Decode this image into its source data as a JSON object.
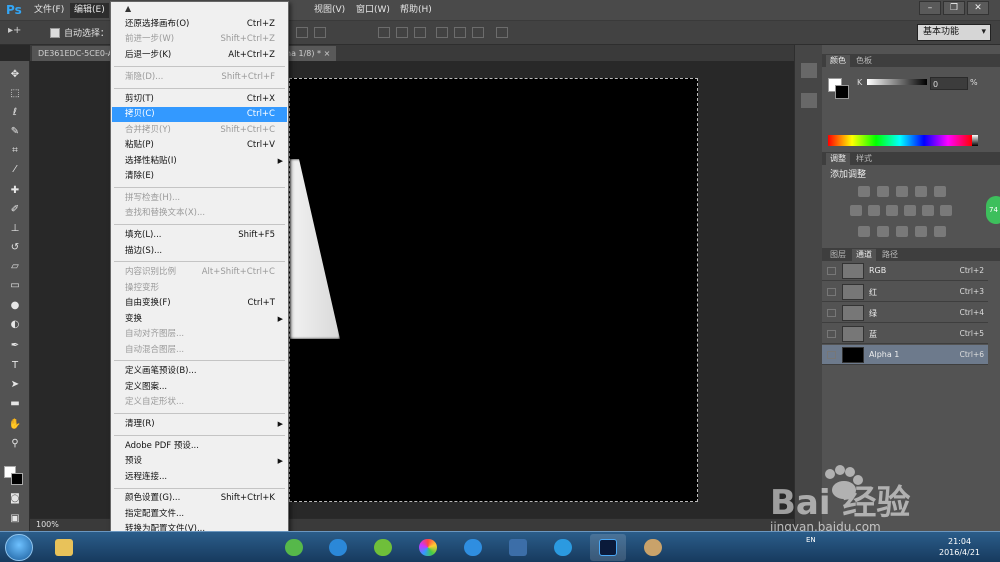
{
  "app": {
    "logo": "Ps"
  },
  "menubar": {
    "items": [
      {
        "label": "文件(F)"
      },
      {
        "label": "编辑(E)"
      },
      {
        "label": "视图(V)"
      },
      {
        "label": "窗口(W)"
      },
      {
        "label": "帮助(H)"
      }
    ]
  },
  "options": {
    "tool_glyph": "▸+",
    "auto_select": "自动选择：",
    "workspace": "基本功能"
  },
  "doc_tabs": [
    {
      "label": "DE361EDC-5CE0-A"
    },
    {
      "label": "ha 1/8) *  ×"
    }
  ],
  "status": {
    "zoom": "100%"
  },
  "edit_menu": {
    "items": [
      {
        "label": "还原选择画布(O)",
        "shortcut": "Ctrl+Z",
        "disabled": false
      },
      {
        "label": "前进一步(W)",
        "shortcut": "Shift+Ctrl+Z",
        "disabled": true
      },
      {
        "label": "后退一步(K)",
        "shortcut": "Alt+Ctrl+Z",
        "disabled": false
      },
      {
        "label": "渐隐(D)...",
        "shortcut": "Shift+Ctrl+F",
        "disabled": true
      },
      {
        "label": "剪切(T)",
        "shortcut": "Ctrl+X",
        "disabled": false
      },
      {
        "label": "拷贝(C)",
        "shortcut": "Ctrl+C",
        "disabled": false,
        "highlight": true
      },
      {
        "label": "合并拷贝(Y)",
        "shortcut": "Shift+Ctrl+C",
        "disabled": true
      },
      {
        "label": "粘贴(P)",
        "shortcut": "Ctrl+V",
        "disabled": false
      },
      {
        "label": "选择性粘贴(I)",
        "shortcut": "",
        "disabled": false,
        "submenu": true
      },
      {
        "label": "清除(E)",
        "shortcut": "",
        "disabled": false
      },
      {
        "label": "拼写检查(H)...",
        "shortcut": "",
        "disabled": true
      },
      {
        "label": "查找和替换文本(X)...",
        "shortcut": "",
        "disabled": true
      },
      {
        "label": "填充(L)...",
        "shortcut": "Shift+F5",
        "disabled": false
      },
      {
        "label": "描边(S)...",
        "shortcut": "",
        "disabled": false
      },
      {
        "label": "内容识别比例",
        "shortcut": "Alt+Shift+Ctrl+C",
        "disabled": true
      },
      {
        "label": "操控变形",
        "shortcut": "",
        "disabled": true
      },
      {
        "label": "自由变换(F)",
        "shortcut": "Ctrl+T",
        "disabled": false
      },
      {
        "label": "变换",
        "shortcut": "",
        "disabled": false,
        "submenu": true
      },
      {
        "label": "自动对齐图层...",
        "shortcut": "",
        "disabled": true
      },
      {
        "label": "自动混合图层...",
        "shortcut": "",
        "disabled": true
      },
      {
        "label": "定义画笔预设(B)...",
        "shortcut": "",
        "disabled": false
      },
      {
        "label": "定义图案...",
        "shortcut": "",
        "disabled": false
      },
      {
        "label": "定义自定形状...",
        "shortcut": "",
        "disabled": true
      },
      {
        "label": "清理(R)",
        "shortcut": "",
        "disabled": false,
        "submenu": true
      },
      {
        "label": "Adobe PDF 预设...",
        "shortcut": "",
        "disabled": false
      },
      {
        "label": "预设",
        "shortcut": "",
        "disabled": false,
        "submenu": true
      },
      {
        "label": "远程连接...",
        "shortcut": "",
        "disabled": false
      },
      {
        "label": "颜色设置(G)...",
        "shortcut": "Shift+Ctrl+K",
        "disabled": false
      },
      {
        "label": "指定配置文件...",
        "shortcut": "",
        "disabled": false
      },
      {
        "label": "转换为配置文件(V)...",
        "shortcut": "",
        "disabled": false
      }
    ]
  },
  "color_panel": {
    "tabs": [
      "颜色",
      "色板"
    ],
    "channel": "K",
    "value": "0",
    "unit": "%"
  },
  "adjust_panel": {
    "tabs": [
      "调整",
      "样式"
    ],
    "title": "添加调整"
  },
  "channels_panel": {
    "tabs": [
      "图层",
      "通道",
      "路径"
    ],
    "rows": [
      {
        "name": "RGB",
        "shortcut": "Ctrl+2"
      },
      {
        "name": "红",
        "shortcut": "Ctrl+3"
      },
      {
        "name": "绿",
        "shortcut": "Ctrl+4"
      },
      {
        "name": "蓝",
        "shortcut": "Ctrl+5"
      },
      {
        "name": "Alpha 1",
        "shortcut": "Ctrl+6"
      }
    ]
  },
  "badge": {
    "value": "74"
  },
  "taskbar": {
    "lang": "EN",
    "time": "21:04",
    "date": "2016/4/21"
  },
  "watermark": {
    "brand": "Bai 经验",
    "url": "jingyan.baidu.com"
  }
}
